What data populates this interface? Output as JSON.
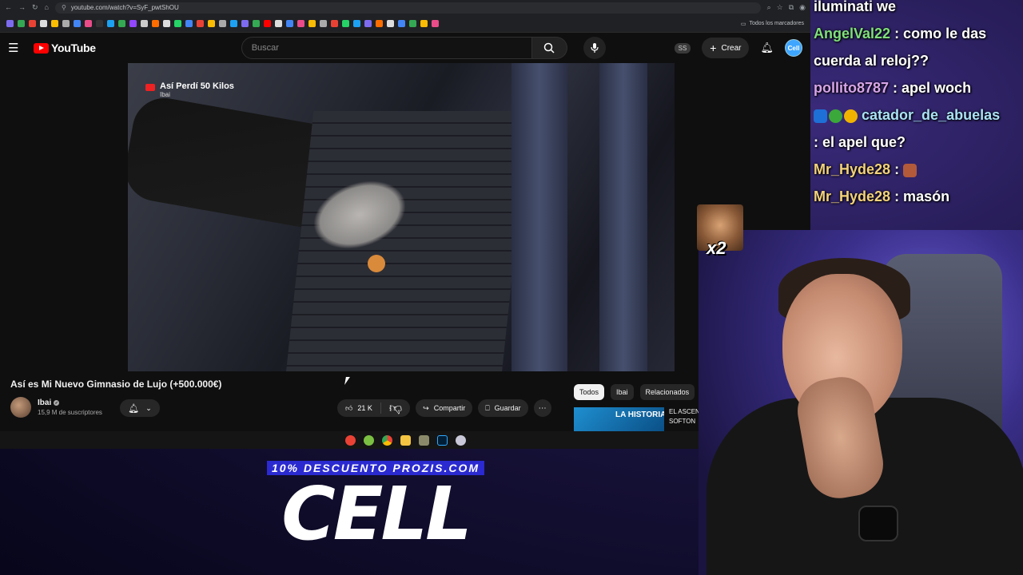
{
  "browser": {
    "url": "youtube.com/watch?v=SyF_pwtShOU",
    "bookmarks_folder": "Todos los marcadores"
  },
  "youtube": {
    "logo": "YouTube",
    "search_placeholder": "Buscar",
    "ss_badge": "SS",
    "create_label": "Crear",
    "avatar_text": "Cell"
  },
  "video": {
    "overlay_title": "Así Perdí 50 Kilos",
    "overlay_channel": "Ibai",
    "title": "Así es Mi Nuevo Gimnasio de Lujo (+500.000€)"
  },
  "channel": {
    "name": "Ibai",
    "subscribers": "15,9 M de suscriptores"
  },
  "actions": {
    "likes": "21 K",
    "share": "Compartir",
    "save": "Guardar"
  },
  "chips": [
    "Todos",
    "Ibai",
    "Relacionados"
  ],
  "recommended": {
    "thumb_text": "LA HISTORIA DE",
    "title_line1": "EL ASCEN",
    "title_line2": "SOFTON"
  },
  "chat": [
    {
      "user": "",
      "text": "iluminati we"
    },
    {
      "user": "AngelVal22",
      "text": ": como le das"
    },
    {
      "user": "",
      "text": "cuerda al reloj??"
    },
    {
      "user": "pollito8787",
      "text": ": apel woch"
    },
    {
      "user": "catador_de_abuelas",
      "text": ""
    },
    {
      "user": "",
      "text": ": el apel que?"
    },
    {
      "user": "Mr_Hyde28",
      "text": ":"
    },
    {
      "user": "Mr_Hyde28",
      "text": ": masón"
    }
  ],
  "overlay": {
    "emote_multiplier": "x2",
    "sponsor_promo": "10% DESCUENTO PROZIS.COM",
    "sponsor_brand": "CELL"
  }
}
